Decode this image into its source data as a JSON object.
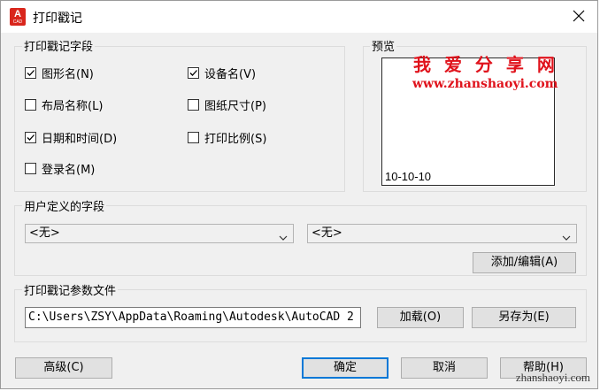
{
  "window": {
    "title": "打印戳记",
    "app_icon_letter": "A",
    "app_icon_sub": "CAD"
  },
  "stamp_fields": {
    "title": "打印戳记字段",
    "items": [
      {
        "label": "图形名(N)",
        "checked": true
      },
      {
        "label": "设备名(V)",
        "checked": true
      },
      {
        "label": "布局名称(L)",
        "checked": false
      },
      {
        "label": "图纸尺寸(P)",
        "checked": false
      },
      {
        "label": "日期和时间(D)",
        "checked": true
      },
      {
        "label": "打印比例(S)",
        "checked": false
      },
      {
        "label": "登录名(M)",
        "checked": false
      }
    ]
  },
  "preview": {
    "title": "预览",
    "stamp_text": "10-10-10"
  },
  "watermark": {
    "cn": "我 爱 分 享 网",
    "url": "www.zhanshaoyi.com",
    "bottom": "zhanshaoyi.com"
  },
  "user_fields": {
    "title": "用户定义的字段",
    "select1": "<无>",
    "select2": "<无>",
    "add_edit": "添加/编辑(A)"
  },
  "param_file": {
    "title": "打印戳记参数文件",
    "path": "C:\\Users\\ZSY\\AppData\\Roaming\\Autodesk\\AutoCAD 2",
    "load": "加载(O)",
    "save_as": "另存为(E)"
  },
  "buttons": {
    "advanced": "高级(C)",
    "ok": "确定",
    "cancel": "取消",
    "help": "帮助(H)"
  }
}
